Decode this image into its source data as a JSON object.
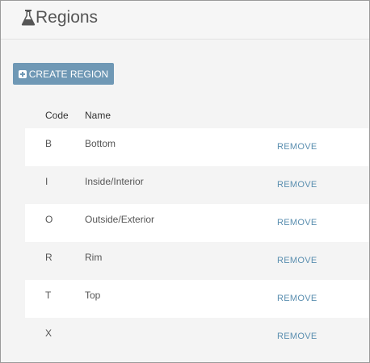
{
  "header": {
    "title": "Regions",
    "icon": "flask-icon"
  },
  "toolbar": {
    "create_label": "CREATE REGION",
    "create_icon": "plus-square-icon"
  },
  "table": {
    "columns": [
      "Code",
      "Name"
    ],
    "rows": [
      {
        "code": "B",
        "name": "Bottom",
        "action": "REMOVE"
      },
      {
        "code": "I",
        "name": "Inside/Interior",
        "action": "REMOVE"
      },
      {
        "code": "O",
        "name": "Outside/Exterior",
        "action": "REMOVE"
      },
      {
        "code": "R",
        "name": "Rim",
        "action": "REMOVE"
      },
      {
        "code": "T",
        "name": "Top",
        "action": "REMOVE"
      },
      {
        "code": "X",
        "name": "",
        "action": "REMOVE"
      }
    ]
  },
  "colors": {
    "accent": "#6f98b5",
    "link": "#5b8fb0"
  }
}
